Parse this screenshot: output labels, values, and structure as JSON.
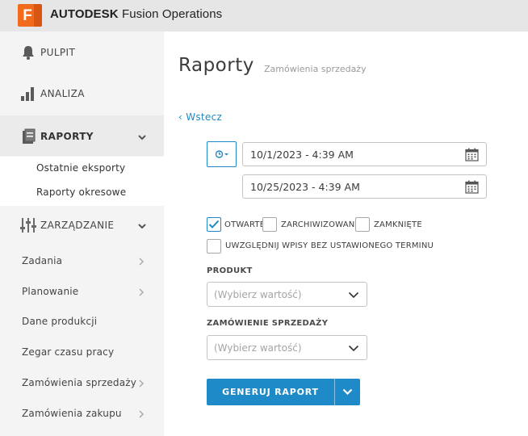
{
  "app": {
    "logo_letter": "F",
    "brand_bold": "AUTODESK",
    "brand_rest": " Fusion Operations",
    "accent_color": "#1f8ac8",
    "logo_color": "#f26a1b"
  },
  "sidebar": {
    "items": [
      {
        "label": "PULPIT",
        "icon": "bell-icon"
      },
      {
        "label": "ANALIZA",
        "icon": "bar-chart-icon"
      },
      {
        "label": "RAPORTY",
        "icon": "report-icon"
      },
      {
        "label": "ZARZĄDZANIE",
        "icon": "sliders-icon"
      }
    ],
    "report_sub": [
      "Ostatnie eksporty",
      "Raporty okresowe"
    ],
    "manage_links": [
      "Zadania",
      "Planowanie",
      "Dane produkcji",
      "Zegar czasu pracy",
      "Zamówienia sprzedaży",
      "Zamówienia zakupu"
    ]
  },
  "main": {
    "title": "Raporty",
    "subtitle": "Zamówienia sprzedaży",
    "back": "‹ Wstecz",
    "date_from": "10/1/2023 - 4:39 AM",
    "date_to": "10/25/2023 - 4:39 AM",
    "filters": [
      {
        "label": "OTWARTE",
        "checked": true
      },
      {
        "label": "ZARCHIWIZOWANE",
        "checked": false
      },
      {
        "label": "ZAMKNIĘTE",
        "checked": false
      }
    ],
    "include_no_deadline": {
      "label": "UWZGLĘDNIJ WPISY BEZ USTAWIONEGO TERMINU",
      "checked": false
    },
    "product_label": "PRODUKT",
    "product_placeholder": "(Wybierz wartość)",
    "order_label": "ZAMÓWIENIE SPRZEDAŻY",
    "order_placeholder": "(Wybierz wartość)",
    "generate_label": "GENERUJ RAPORT"
  }
}
